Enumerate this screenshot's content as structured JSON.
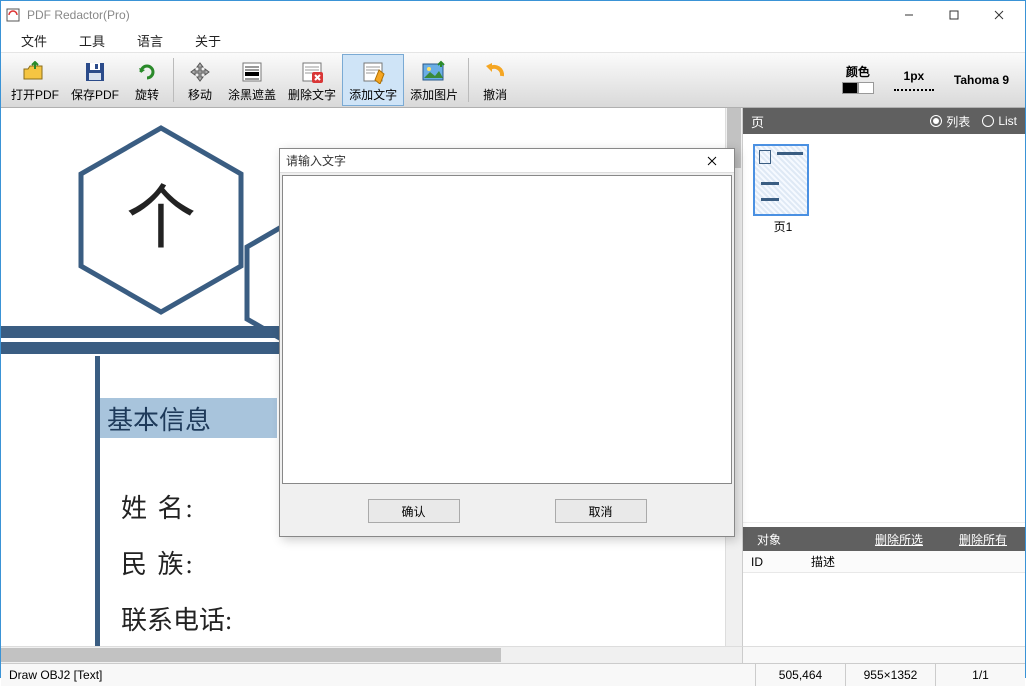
{
  "window": {
    "title": "PDF Redactor(Pro)"
  },
  "menu": {
    "file": "文件",
    "tools": "工具",
    "lang": "语言",
    "about": "关于"
  },
  "toolbar": {
    "open": "打开PDF",
    "save": "保存PDF",
    "rotate": "旋转",
    "move": "移动",
    "blackout": "涂黑遮盖",
    "deltext": "删除文字",
    "addtext": "添加文字",
    "addimg": "添加图片",
    "undo": "撤消",
    "color_label": "颜色",
    "px_label": "1px",
    "font_label": "Tahoma 9"
  },
  "sidebar": {
    "pages_title": "页",
    "view_list": "列表",
    "view_thumb": "List",
    "page1_label": "页1",
    "objects_title": "对象",
    "del_selected": "删除所选",
    "del_all": "删除所有",
    "col_id": "ID",
    "col_desc": "描述"
  },
  "dialog": {
    "title": "请输入文字",
    "ok": "确认",
    "cancel": "取消"
  },
  "document": {
    "heading": "基本信息",
    "row1": "姓       名:",
    "row2": "民       族:",
    "row3": "联系电话:"
  },
  "status": {
    "msg": "Draw OBJ2 [Text]",
    "coords": "505,464",
    "size": "955×1352",
    "page": "1/1"
  }
}
